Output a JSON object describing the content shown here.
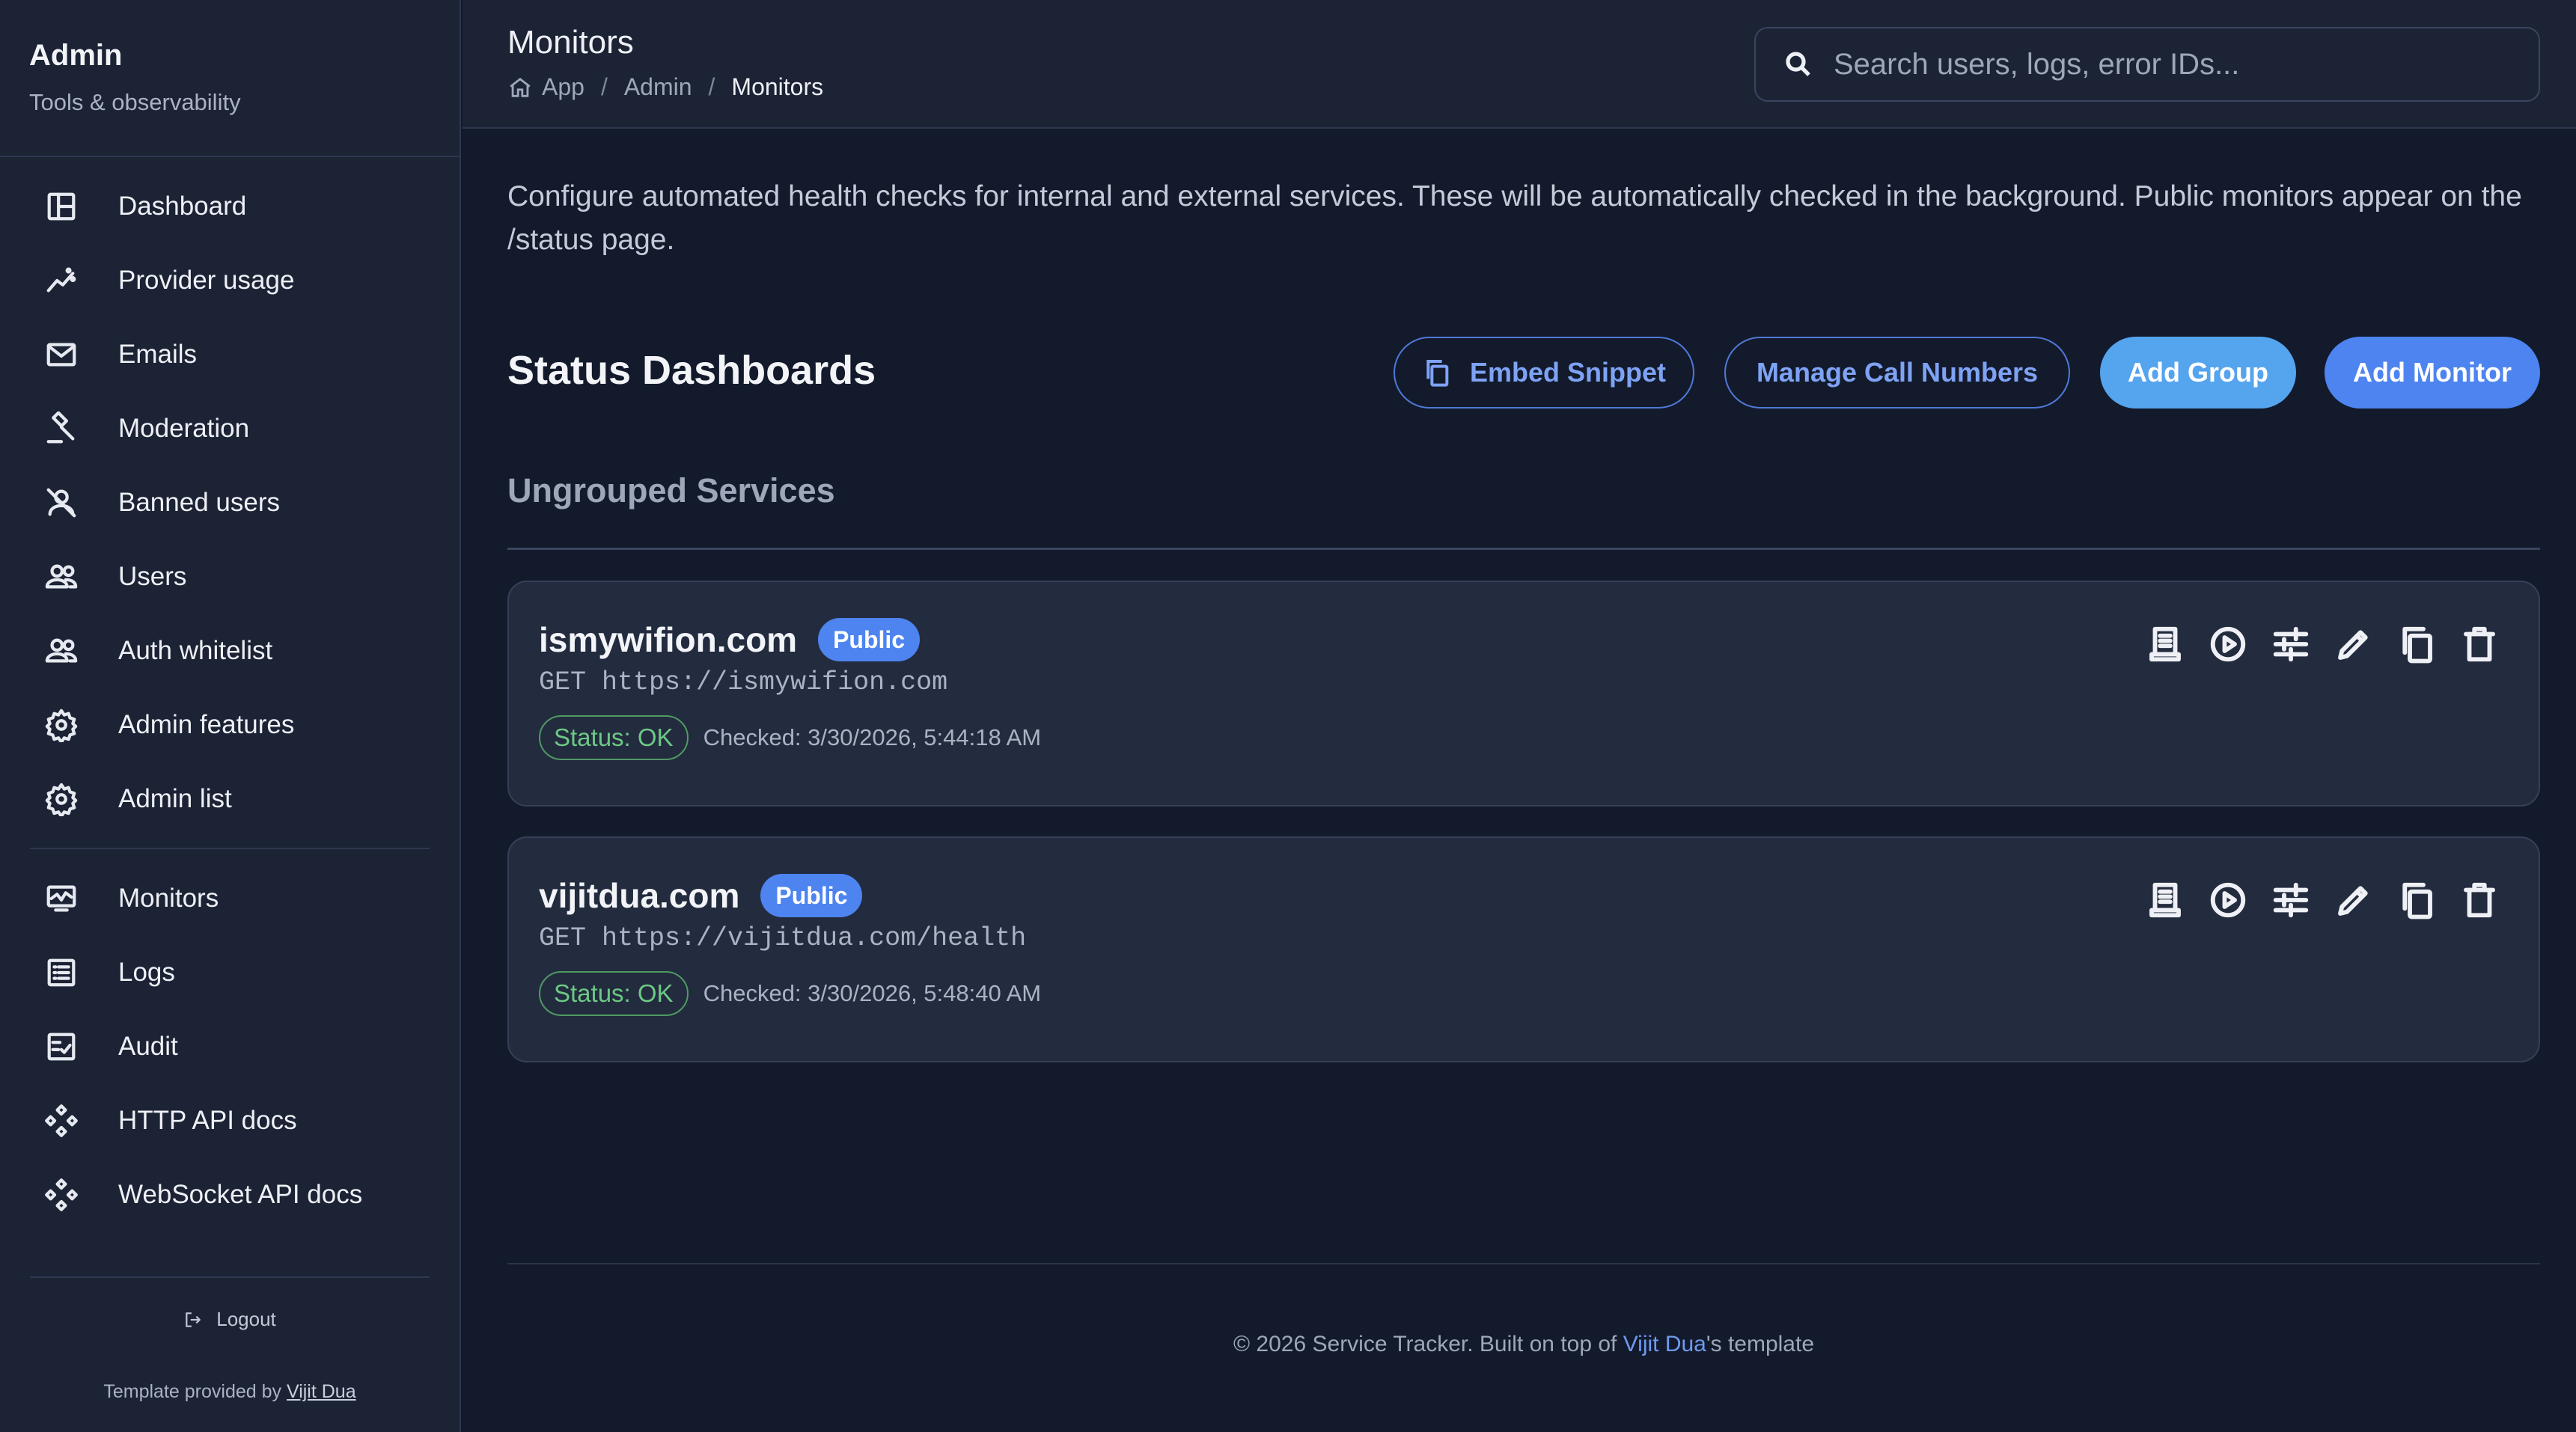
{
  "sidebar": {
    "title": "Admin",
    "subtitle": "Tools & observability",
    "items": [
      {
        "label": "Dashboard",
        "icon": "dashboard-icon"
      },
      {
        "label": "Provider usage",
        "icon": "chart-line-icon"
      },
      {
        "label": "Emails",
        "icon": "mail-icon"
      },
      {
        "label": "Moderation",
        "icon": "gavel-icon"
      },
      {
        "label": "Banned users",
        "icon": "user-off-icon"
      },
      {
        "label": "Users",
        "icon": "users-icon"
      },
      {
        "label": "Auth whitelist",
        "icon": "users-icon"
      },
      {
        "label": "Admin features",
        "icon": "gear-icon"
      },
      {
        "label": "Admin list",
        "icon": "gear-icon"
      }
    ],
    "items2": [
      {
        "label": "Monitors",
        "icon": "monitor-icon"
      },
      {
        "label": "Logs",
        "icon": "list-icon"
      },
      {
        "label": "Audit",
        "icon": "checklist-icon"
      },
      {
        "label": "HTTP API docs",
        "icon": "api-icon"
      },
      {
        "label": "WebSocket API docs",
        "icon": "api-icon"
      }
    ],
    "logout": "Logout",
    "credit_prefix": "Template provided by",
    "credit_name": "Vijit Dua"
  },
  "header": {
    "title": "Monitors",
    "breadcrumb": [
      "App",
      "Admin",
      "Monitors"
    ],
    "search_placeholder": "Search users, logs, error IDs..."
  },
  "main": {
    "intro": "Configure automated health checks for internal and external services. These will be automatically checked in the background. Public monitors appear on the /status page.",
    "section_title": "Status Dashboards",
    "buttons": {
      "embed": "Embed Snippet",
      "calls": "Manage Call Numbers",
      "group": "Add Group",
      "monitor": "Add Monitor"
    },
    "subsection": "Ungrouped Services",
    "monitors": [
      {
        "name": "ismywifion.com",
        "badge": "Public",
        "method_url": "GET https://ismywifion.com",
        "status": "Status: OK",
        "checked": "Checked: 3/30/2026, 5:44:18 AM"
      },
      {
        "name": "vijitdua.com",
        "badge": "Public",
        "method_url": "GET https://vijitdua.com/health",
        "status": "Status: OK",
        "checked": "Checked: 3/30/2026, 5:48:40 AM"
      }
    ]
  },
  "footer": {
    "prefix": "© 2026 Service Tracker. Built on top of",
    "link": "Vijit Dua",
    "suffix": "'s template"
  },
  "colors": {
    "background": "#131a2c",
    "sidebar": "#1b2335",
    "accent": "#4d84f0",
    "status_ok": "#6cc985"
  }
}
